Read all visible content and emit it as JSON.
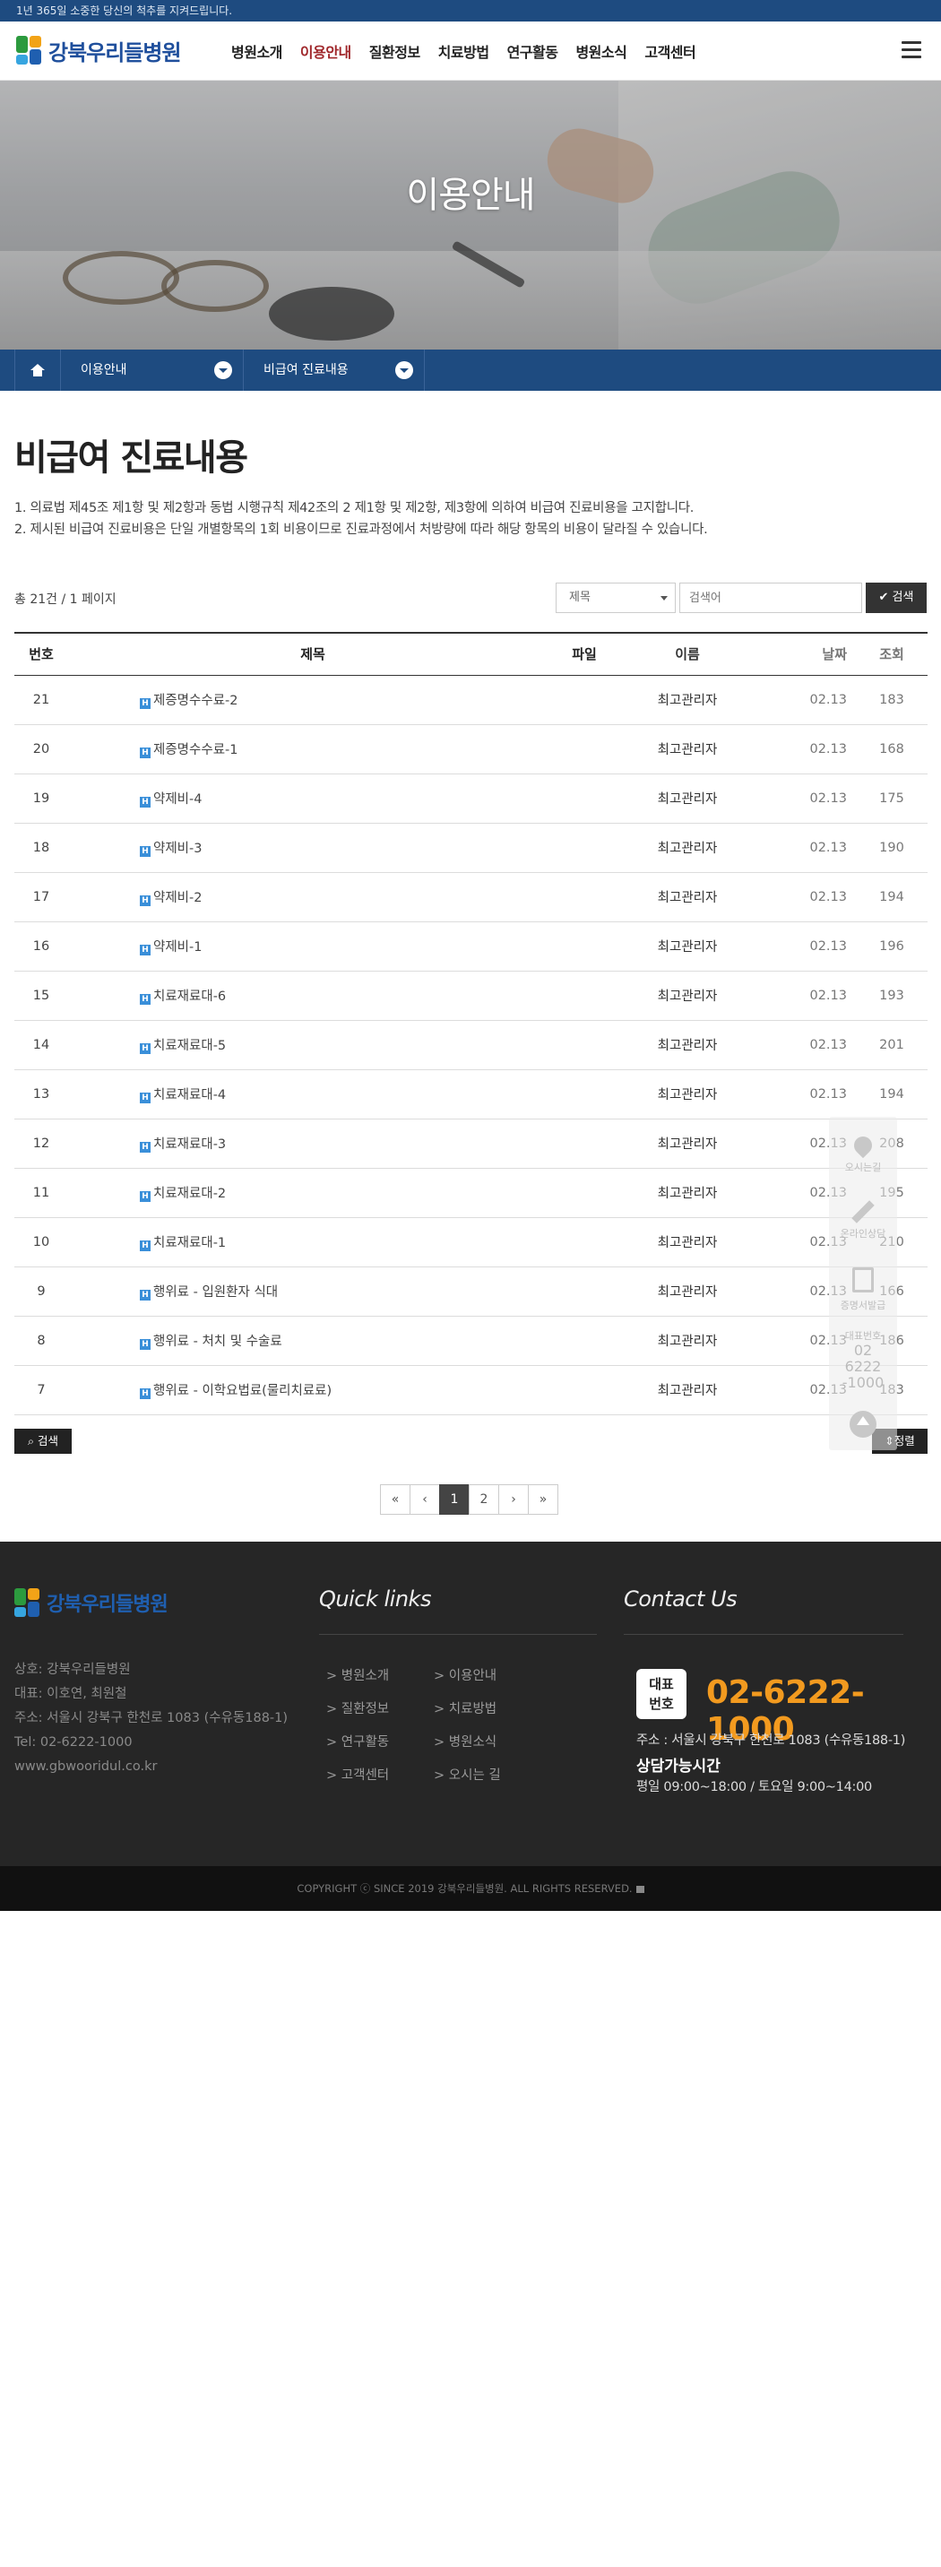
{
  "top_strip": {
    "text": "1년 365일 소중한 당신의 척추를 지켜드립니다."
  },
  "header": {
    "logo_text": "강북우리들병원",
    "nav": [
      {
        "label": "병원소개",
        "active": false
      },
      {
        "label": "이용안내",
        "active": true
      },
      {
        "label": "질환정보",
        "active": false
      },
      {
        "label": "치료방법",
        "active": false
      },
      {
        "label": "연구활동",
        "active": false
      },
      {
        "label": "병원소식",
        "active": false
      },
      {
        "label": "고객센터",
        "active": false
      }
    ],
    "menu_icon": "hamburger-icon"
  },
  "hero": {
    "title": "이용안내"
  },
  "breadcrumb": {
    "home_icon": "home-icon",
    "level1": "이용안내",
    "level2": "비급여 진료내용"
  },
  "page": {
    "title": "비급여 진료내용",
    "notice_1": "1. 의료법 제45조 제1항 및 제2항과 동법 시행규칙 제42조의 2 제1항 및 제2항, 제3항에 의하여 비급여 진료비용을 고지합니다.",
    "notice_2": "2. 제시된 비급여 진료비용은 단일 개별항목의 1회 비용이므로 진료과정에서 처방량에 따라 해당 항목의 비용이 달라질 수 있습니다."
  },
  "list": {
    "total_text": "총 21건 / 1 페이지",
    "search_field_selected": "제목",
    "search_placeholder": "검색어",
    "search_button": "검색",
    "columns": {
      "no": "번호",
      "title": "제목",
      "file": "파일",
      "name": "이름",
      "date": "날짜",
      "views": "조회"
    },
    "rows": [
      {
        "no": "21",
        "title": "제증명수수료-2",
        "name": "최고관리자",
        "date": "02.13",
        "views": "183"
      },
      {
        "no": "20",
        "title": "제증명수수료-1",
        "name": "최고관리자",
        "date": "02.13",
        "views": "168"
      },
      {
        "no": "19",
        "title": "약제비-4",
        "name": "최고관리자",
        "date": "02.13",
        "views": "175"
      },
      {
        "no": "18",
        "title": "약제비-3",
        "name": "최고관리자",
        "date": "02.13",
        "views": "190"
      },
      {
        "no": "17",
        "title": "약제비-2",
        "name": "최고관리자",
        "date": "02.13",
        "views": "194"
      },
      {
        "no": "16",
        "title": "약제비-1",
        "name": "최고관리자",
        "date": "02.13",
        "views": "196"
      },
      {
        "no": "15",
        "title": "치료재료대-6",
        "name": "최고관리자",
        "date": "02.13",
        "views": "193"
      },
      {
        "no": "14",
        "title": "치료재료대-5",
        "name": "최고관리자",
        "date": "02.13",
        "views": "201"
      },
      {
        "no": "13",
        "title": "치료재료대-4",
        "name": "최고관리자",
        "date": "02.13",
        "views": "194"
      },
      {
        "no": "12",
        "title": "치료재료대-3",
        "name": "최고관리자",
        "date": "02.13",
        "views": "208"
      },
      {
        "no": "11",
        "title": "치료재료대-2",
        "name": "최고관리자",
        "date": "02.13",
        "views": "195"
      },
      {
        "no": "10",
        "title": "치료재료대-1",
        "name": "최고관리자",
        "date": "02.13",
        "views": "210"
      },
      {
        "no": "9",
        "title": "행위료 - 입원환자 식대",
        "name": "최고관리자",
        "date": "02.13",
        "views": "166"
      },
      {
        "no": "8",
        "title": "행위료 - 처치 및 수술료",
        "name": "최고관리자",
        "date": "02.13",
        "views": "186"
      },
      {
        "no": "7",
        "title": "행위료 - 이학요법료(물리치료료)",
        "name": "최고관리자",
        "date": "02.13",
        "views": "183"
      }
    ],
    "bottom_search_button": "검색",
    "sort_button": "정렬",
    "hot_icon": "hot-badge-icon"
  },
  "pagination": {
    "first": "«",
    "prev": "‹",
    "pages": [
      "1",
      "2"
    ],
    "current": "1",
    "next": "›",
    "last": "»"
  },
  "quickbar": {
    "location_label": "오시는길",
    "reservation_label": "온라인상담",
    "certificate_label": "증명서발급",
    "phone_label": "대표번호",
    "phone_value_1": "02",
    "phone_value_2": "6222",
    "phone_value_3": "-1000",
    "top_icon": "arrow-up-icon"
  },
  "footer": {
    "logo_text": "강북우리들병원",
    "info": [
      "상호: 강북우리들병원",
      "대표: 이호연, 최원철",
      "주소: 서울시 강북구 한천로 1083 (수유동188-1)",
      "Tel: 02-6222-1000",
      "www.gbwooridul.co.kr"
    ],
    "quick_links_title": "Quick links",
    "quick_links": [
      "병원소개",
      "이용안내",
      "질환정보",
      "치료방법",
      "연구활동",
      "병원소식",
      "고객센터",
      "오시는 길"
    ],
    "contact_title": "Contact Us",
    "rep_badge_1": "대표",
    "rep_badge_2": "번호",
    "phone": "02-6222-1000",
    "address": "주소 : 서울시 강북구 한천로 1083 (수유동188-1)",
    "hours_title": "상담가능시간",
    "hours": "평일 09:00~18:00 / 토요일 9:00~14:00",
    "copyright": "COPYRIGHT ⓒ SINCE 2019 강북우리들병원. ALL RIGHTS RESERVED."
  },
  "colors": {
    "brand_blue": "#1e4b80",
    "accent_orange": "#f29a1f",
    "active_red": "#a0282c"
  }
}
